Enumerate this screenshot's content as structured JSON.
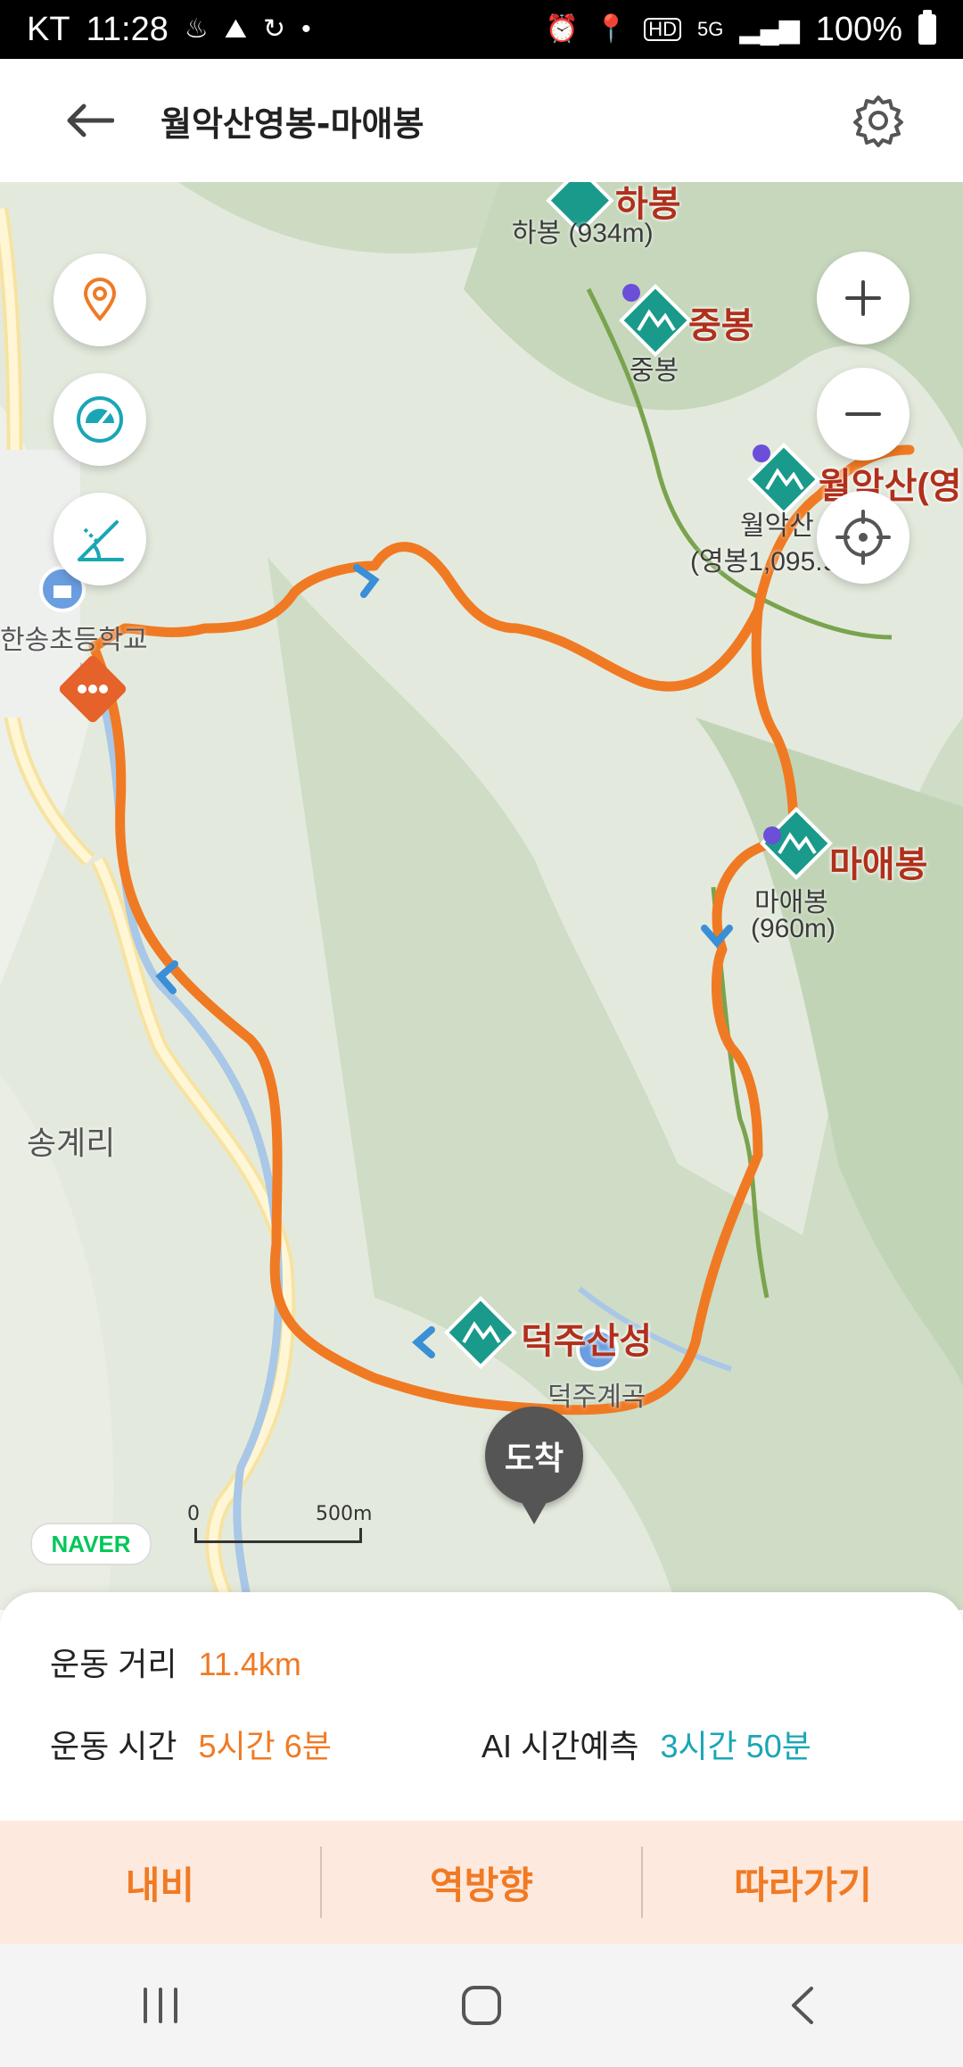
{
  "status_bar": {
    "carrier": "KT",
    "time": "11:28",
    "network": "5G",
    "battery": "100%"
  },
  "header": {
    "title": "월악산영봉-마애봉"
  },
  "map": {
    "peaks": [
      {
        "name": "하봉",
        "sub": "하봉 (934m)"
      },
      {
        "name": "중봉",
        "sub": "중봉"
      },
      {
        "name": "월악산(영",
        "sub1": "월악산",
        "sub2": "(영봉1,095.9"
      },
      {
        "name": "마애봉",
        "sub1": "마애봉",
        "sub2": "(960m)"
      },
      {
        "name": "덕주산성"
      }
    ],
    "places": {
      "school": "한송초등학교",
      "village": "송계리",
      "valley": "덕주계곡"
    },
    "arrival_label": "도착",
    "naver_logo": "NAVER",
    "scale": {
      "start": "0",
      "end": "500m"
    },
    "route_color": "#f07a23"
  },
  "stats": {
    "distance_label": "운동 거리",
    "distance_value": "11.4km",
    "time_label": "운동 시간",
    "time_value": "5시간 6분",
    "ai_label": "AI 시간예측",
    "ai_value": "3시간 50분"
  },
  "actions": {
    "navigate": "내비",
    "reverse": "역방향",
    "follow": "따라가기"
  }
}
